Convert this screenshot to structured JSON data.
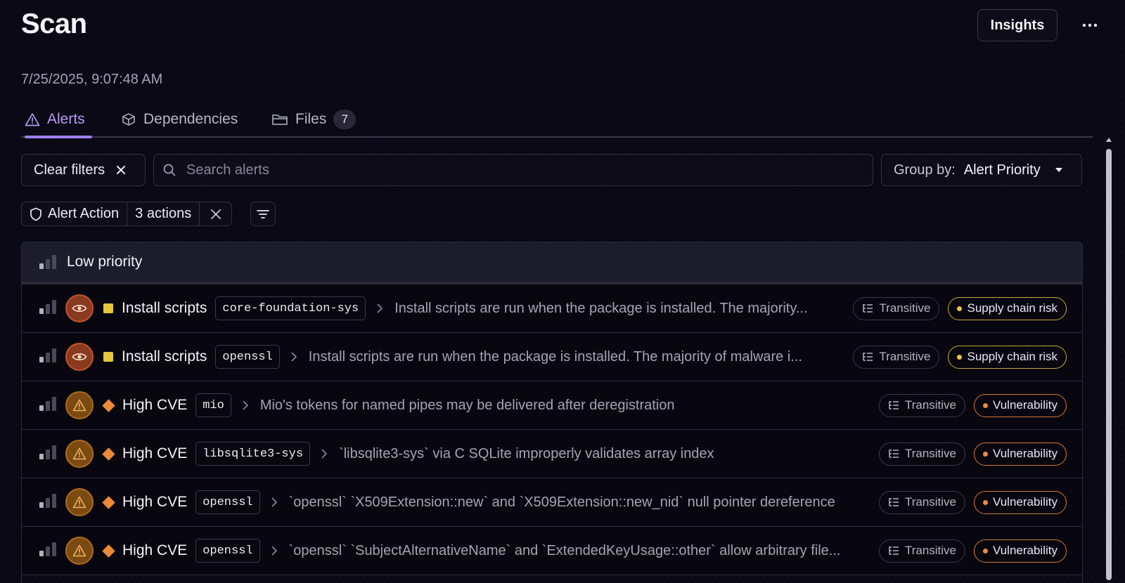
{
  "header": {
    "title": "Scan",
    "insights_label": "Insights",
    "more_label": "More options",
    "timestamp": "7/25/2025, 9:07:48 AM"
  },
  "tabs": [
    {
      "label": "Alerts",
      "icon": "alert-triangle-icon",
      "active": true
    },
    {
      "label": "Dependencies",
      "icon": "package-icon",
      "active": false
    },
    {
      "label": "Files",
      "icon": "folder-icon",
      "active": false,
      "count": "7"
    }
  ],
  "toolbar": {
    "clear_filters_label": "Clear filters",
    "search_placeholder": "Search alerts",
    "search_value": "",
    "group_by_label": "Group by:",
    "group_by_value": "Alert Priority"
  },
  "active_filter": {
    "name": "Alert Action",
    "value": "3 actions"
  },
  "group": {
    "label": "Low priority"
  },
  "alerts": [
    {
      "avatar": "eye",
      "severity": "square",
      "type": "Install scripts",
      "package": "core-foundation-sys",
      "description": "Install scripts are run when the package is installed. The majority...",
      "dependency": "Transitive",
      "category": "Supply chain risk",
      "category_kind": "supply"
    },
    {
      "avatar": "eye",
      "severity": "square",
      "type": "Install scripts",
      "package": "openssl",
      "description": "Install scripts are run when the package is installed. The majority of malware i...",
      "dependency": "Transitive",
      "category": "Supply chain risk",
      "category_kind": "supply"
    },
    {
      "avatar": "warn",
      "severity": "diamond",
      "type": "High CVE",
      "package": "mio",
      "description": "Mio's tokens for named pipes may be delivered after deregistration",
      "dependency": "Transitive",
      "category": "Vulnerability",
      "category_kind": "vuln"
    },
    {
      "avatar": "warn",
      "severity": "diamond",
      "type": "High CVE",
      "package": "libsqlite3-sys",
      "description": "`libsqlite3-sys` via C SQLite improperly validates array index",
      "dependency": "Transitive",
      "category": "Vulnerability",
      "category_kind": "vuln"
    },
    {
      "avatar": "warn",
      "severity": "diamond",
      "type": "High CVE",
      "package": "openssl",
      "description": "`openssl` `X509Extension::new` and `X509Extension::new_nid` null pointer dereference",
      "dependency": "Transitive",
      "category": "Vulnerability",
      "category_kind": "vuln"
    },
    {
      "avatar": "warn",
      "severity": "diamond",
      "type": "High CVE",
      "package": "openssl",
      "description": "`openssl` `SubjectAlternativeName` and `ExtendedKeyUsage::other` allow arbitrary file...",
      "dependency": "Transitive",
      "category": "Vulnerability",
      "category_kind": "vuln"
    }
  ],
  "colors": {
    "accent": "#9f7ef0",
    "supply_chain": "#e6c63d",
    "vulnerability": "#ec8a3a",
    "background": "#090814"
  }
}
